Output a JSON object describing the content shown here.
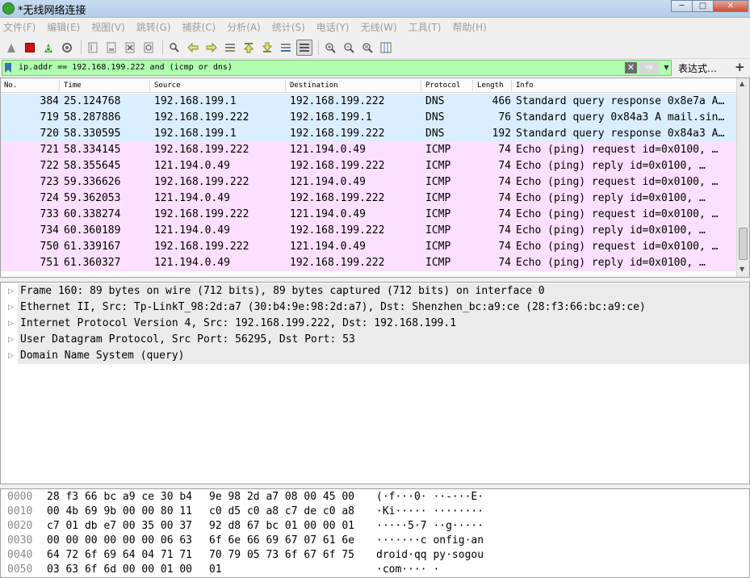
{
  "window": {
    "title": "*无线网络连接",
    "buttons": {
      "minimize": "─",
      "maximize": "□",
      "close": "✕"
    }
  },
  "menu": [
    "文件(F)",
    "编辑(E)",
    "视图(V)",
    "跳转(G)",
    "捕获(C)",
    "分析(A)",
    "统计(S)",
    "电话(Y)",
    "无线(W)",
    "工具(T)",
    "帮助(H)"
  ],
  "toolbar": {
    "icons": [
      "shark-fin-start-icon",
      "stop-capture-icon",
      "restart-capture-icon",
      "capture-options-icon",
      "open-file-icon",
      "save-file-icon",
      "close-file-icon",
      "reload-file-icon",
      "find-packet-icon",
      "go-back-icon",
      "go-forward-icon",
      "go-to-packet-icon",
      "go-first-icon",
      "go-last-icon",
      "auto-scroll-icon",
      "colorize-icon",
      "zoom-in-icon",
      "zoom-out-icon",
      "zoom-normal-icon",
      "resize-columns-icon"
    ],
    "colors": {
      "stop": "#d01010",
      "start": "#7a7a7a",
      "restart": "#3aa537"
    }
  },
  "filter": {
    "value": "ip.addr == 192.168.199.222 and (icmp or dns)",
    "background": "#afffaf",
    "expression_label": "表达式…",
    "add_label": "+"
  },
  "packet_list": {
    "headers": {
      "no": "No.",
      "time": "Time",
      "source": "Source",
      "destination": "Destination",
      "protocol": "Protocol",
      "length": "Length",
      "info": "Info"
    },
    "colors": {
      "dns": "#daeeff",
      "icmp": "#fce0ff"
    },
    "rows": [
      {
        "no": "384",
        "time": "25.124768",
        "source": "192.168.199.1",
        "destination": "192.168.199.222",
        "protocol": "DNS",
        "length": "466",
        "info": "Standard query response 0x8e7a A…"
      },
      {
        "no": "719",
        "time": "58.287886",
        "source": "192.168.199.222",
        "destination": "192.168.199.1",
        "protocol": "DNS",
        "length": "76",
        "info": "Standard query 0x84a3 A mail.sin…"
      },
      {
        "no": "720",
        "time": "58.330595",
        "source": "192.168.199.1",
        "destination": "192.168.199.222",
        "protocol": "DNS",
        "length": "192",
        "info": "Standard query response 0x84a3 A…"
      },
      {
        "no": "721",
        "time": "58.334145",
        "source": "192.168.199.222",
        "destination": "121.194.0.49",
        "protocol": "ICMP",
        "length": "74",
        "info": "Echo (ping) request  id=0x0100, …"
      },
      {
        "no": "722",
        "time": "58.355645",
        "source": "121.194.0.49",
        "destination": "192.168.199.222",
        "protocol": "ICMP",
        "length": "74",
        "info": "Echo (ping) reply    id=0x0100, …"
      },
      {
        "no": "723",
        "time": "59.336626",
        "source": "192.168.199.222",
        "destination": "121.194.0.49",
        "protocol": "ICMP",
        "length": "74",
        "info": "Echo (ping) request  id=0x0100, …"
      },
      {
        "no": "724",
        "time": "59.362053",
        "source": "121.194.0.49",
        "destination": "192.168.199.222",
        "protocol": "ICMP",
        "length": "74",
        "info": "Echo (ping) reply    id=0x0100, …"
      },
      {
        "no": "733",
        "time": "60.338274",
        "source": "192.168.199.222",
        "destination": "121.194.0.49",
        "protocol": "ICMP",
        "length": "74",
        "info": "Echo (ping) request  id=0x0100, …"
      },
      {
        "no": "734",
        "time": "60.360189",
        "source": "121.194.0.49",
        "destination": "192.168.199.222",
        "protocol": "ICMP",
        "length": "74",
        "info": "Echo (ping) reply    id=0x0100, …"
      },
      {
        "no": "750",
        "time": "61.339167",
        "source": "192.168.199.222",
        "destination": "121.194.0.49",
        "protocol": "ICMP",
        "length": "74",
        "info": "Echo (ping) request  id=0x0100, …"
      },
      {
        "no": "751",
        "time": "61.360327",
        "source": "121.194.0.49",
        "destination": "192.168.199.222",
        "protocol": "ICMP",
        "length": "74",
        "info": "Echo (ping) reply    id=0x0100, …"
      }
    ]
  },
  "details": [
    "Frame 160: 89 bytes on wire (712 bits), 89 bytes captured (712 bits) on interface 0",
    "Ethernet II, Src: Tp-LinkT_98:2d:a7 (30:b4:9e:98:2d:a7), Dst: Shenzhen_bc:a9:ce (28:f3:66:bc:a9:ce)",
    "Internet Protocol Version 4, Src: 192.168.199.222, Dst: 192.168.199.1",
    "User Datagram Protocol, Src Port: 56295, Dst Port: 53",
    "Domain Name System (query)"
  ],
  "bytes": [
    {
      "offset": "0000",
      "hex1": "28 f3 66 bc a9 ce 30 b4",
      "hex2": "9e 98 2d a7 08 00 45 00",
      "ascii": "(·f···0· ··-···E·"
    },
    {
      "offset": "0010",
      "hex1": "00 4b 69 9b 00 00 80 11",
      "hex2": "c0 d5 c0 a8 c7 de c0 a8",
      "ascii": "·Ki····· ········"
    },
    {
      "offset": "0020",
      "hex1": "c7 01 db e7 00 35 00 37",
      "hex2": "92 d8 67 bc 01 00 00 01",
      "ascii": "·····5·7 ··g·····"
    },
    {
      "offset": "0030",
      "hex1": "00 00 00 00 00 00 06 63",
      "hex2": "6f 6e 66 69 67 07 61 6e",
      "ascii": "·······c onfig·an"
    },
    {
      "offset": "0040",
      "hex1": "64 72 6f 69 64 04 71 71",
      "hex2": "70 79 05 73 6f 67 6f 75",
      "ascii": "droid·qq py·sogou"
    },
    {
      "offset": "0050",
      "hex1": "03 63 6f 6d 00 00 01 00",
      "hex2": "01",
      "ascii": "·com···· ·"
    }
  ]
}
